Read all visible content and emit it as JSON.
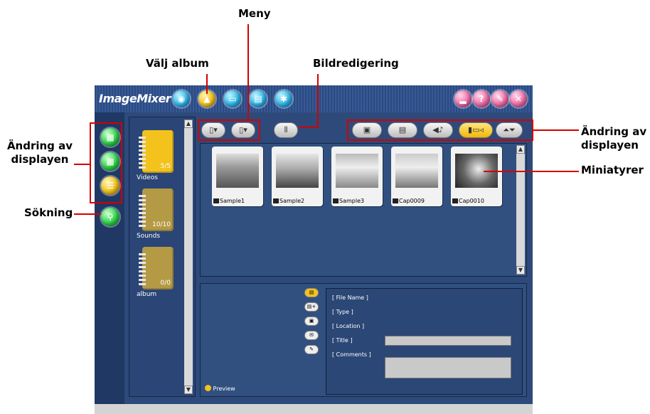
{
  "callouts": {
    "meny": "Meny",
    "valj_album": "Välj album",
    "bildredigering": "Bildredigering",
    "andring_left_1": "Ändring av",
    "andring_left_2": "displayen",
    "sokning": "Sökning",
    "andring_right_1": "Ändring av",
    "andring_right_2": "displayen",
    "miniatyrer": "Miniatyrer"
  },
  "app": {
    "logo": "ImageMixer"
  },
  "albums": [
    {
      "label": "Videos",
      "count": "5/5",
      "color": "#f3c21c"
    },
    {
      "label": "Sounds",
      "count": "10/10",
      "color": "#b59a45"
    },
    {
      "label": "album",
      "count": "0/0",
      "color": "#b59a45"
    }
  ],
  "thumbnails": [
    {
      "name": "Sample1"
    },
    {
      "name": "Sample2"
    },
    {
      "name": "Sample3"
    },
    {
      "name": "Cap0009"
    },
    {
      "name": "Cap0010"
    }
  ],
  "info": {
    "file_name": "[ File Name ]",
    "type": "[ Type ]",
    "location": "[ Location ]",
    "title": "[ Title ]",
    "comments": "[ Comments ]",
    "preview": "Preview"
  },
  "colors": {
    "callout_red": "#d40000",
    "app_bg": "#2d4a7a",
    "accent_yellow": "#f3c21c"
  }
}
